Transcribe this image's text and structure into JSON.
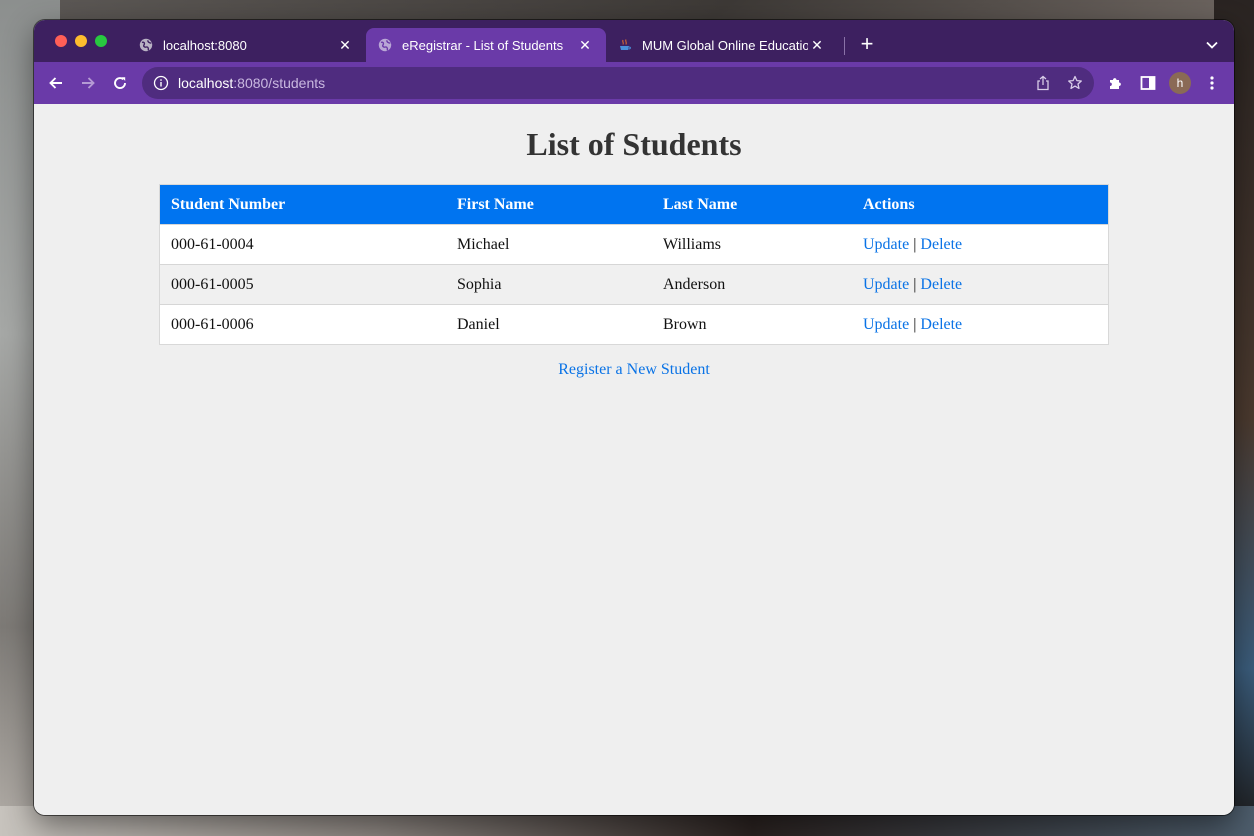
{
  "browser": {
    "tabs": [
      {
        "title": "localhost:8080",
        "active": false,
        "favicon": "globe-icon"
      },
      {
        "title": "eRegistrar - List of Students",
        "active": true,
        "favicon": "globe-icon"
      },
      {
        "title": "MUM Global Online Education ::",
        "active": false,
        "favicon": "java-cup-icon"
      }
    ],
    "url_host": "localhost",
    "url_path": ":8080/students",
    "profile_initial": "h",
    "colors": {
      "tabstrip": "#3d2060",
      "toolbar": "#6a3aa8",
      "omnibox": "#4f2c7f"
    }
  },
  "page": {
    "title": "List of Students",
    "table": {
      "headers": [
        "Student Number",
        "First Name",
        "Last Name",
        "Actions"
      ],
      "rows": [
        {
          "student_number": "000-61-0004",
          "first_name": "Michael",
          "last_name": "Williams",
          "update": "Update",
          "separator": "|",
          "delete": "Delete"
        },
        {
          "student_number": "000-61-0005",
          "first_name": "Sophia",
          "last_name": "Anderson",
          "update": "Update",
          "separator": "|",
          "delete": "Delete"
        },
        {
          "student_number": "000-61-0006",
          "first_name": "Daniel",
          "last_name": "Brown",
          "update": "Update",
          "separator": "|",
          "delete": "Delete"
        }
      ]
    },
    "register_link": "Register a New Student",
    "colors": {
      "header_bg": "#0074f0",
      "link": "#0a73e6",
      "page_bg": "#efefef"
    }
  }
}
